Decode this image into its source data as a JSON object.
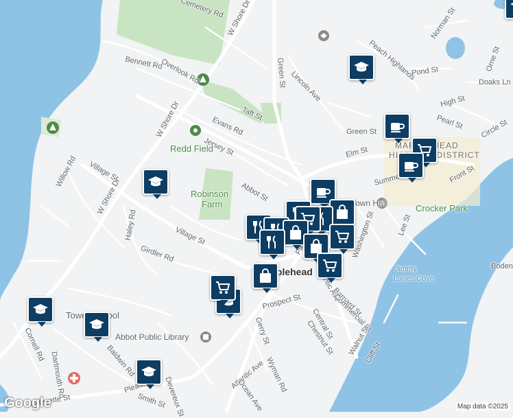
{
  "streets": [
    {
      "name": "Cemetery Rd",
      "rot": 20
    },
    {
      "name": "W Shore Dr",
      "rot": -62
    },
    {
      "name": "Bennett Rd",
      "rot": 12
    },
    {
      "name": "Overlook Rd",
      "rot": 30
    },
    {
      "name": "Green St",
      "rot": 85
    },
    {
      "name": "Lincoln Ave",
      "rot": 45
    },
    {
      "name": "Peach Highlands",
      "rot": 40
    },
    {
      "name": "Pond St",
      "rot": -8
    },
    {
      "name": "Norman St",
      "rot": -55
    },
    {
      "name": "Orne St",
      "rot": -70
    },
    {
      "name": "Doaks Ln",
      "rot": 0
    },
    {
      "name": "Taft St",
      "rot": 25
    },
    {
      "name": "Evans Rd",
      "rot": 25
    },
    {
      "name": "High St",
      "rot": -15
    },
    {
      "name": "Pearl St",
      "rot": 20
    },
    {
      "name": "Circle St",
      "rot": -30
    },
    {
      "name": "W Shore Dr",
      "rot": -62
    },
    {
      "name": "Green St",
      "rot": 0
    },
    {
      "name": "Elm St",
      "rot": -15
    },
    {
      "name": "Jersey St",
      "rot": 25
    },
    {
      "name": "Willow Rd",
      "rot": -62
    },
    {
      "name": "Village St",
      "rot": 30
    },
    {
      "name": "W Shore Dr",
      "rot": -62
    },
    {
      "name": "Abbot St",
      "rot": 30
    },
    {
      "name": "Summer St",
      "rot": -15
    },
    {
      "name": "Front St",
      "rot": -30
    },
    {
      "name": "Haley Rd",
      "rot": -80
    },
    {
      "name": "Village St",
      "rot": 25
    },
    {
      "name": "Girdler Rd",
      "rot": 20
    },
    {
      "name": "Lee St",
      "rot": -70
    },
    {
      "name": "Pleasant St",
      "rot": -60
    },
    {
      "name": "Prospect St",
      "rot": -15
    },
    {
      "name": "Atlantic Ave",
      "rot": 60
    },
    {
      "name": "Barnard St",
      "rot": 45
    },
    {
      "name": "Commercial St",
      "rot": 45
    },
    {
      "name": "Central St",
      "rot": 60
    },
    {
      "name": "Gerry St",
      "rot": 70
    },
    {
      "name": "Chestnut St",
      "rot": 55
    },
    {
      "name": "Walnut St",
      "rot": -60
    },
    {
      "name": "Cliff St",
      "rot": -60
    },
    {
      "name": "Cornell Rd",
      "rot": 65
    },
    {
      "name": "Baldwin Rd",
      "rot": 50
    },
    {
      "name": "Dartmouth Rd",
      "rot": 80
    },
    {
      "name": "Atlantic Ave",
      "rot": -40
    },
    {
      "name": "Wyman Rd",
      "rot": 65
    },
    {
      "name": "Pleasant St",
      "rot": -20
    },
    {
      "name": "Lafayette St",
      "rot": -10
    },
    {
      "name": "Smith St",
      "rot": 20
    },
    {
      "name": "Devereux St",
      "rot": 70
    },
    {
      "name": "Ocean Ave",
      "rot": 55
    },
    {
      "name": "Washington St",
      "rot": -70
    }
  ],
  "places": {
    "redd_field": "Redd Field",
    "robinson_farm_1": "Robinson",
    "robinson_farm_2": "Farm",
    "district_1": "MARBLEHEAD",
    "district_2": "HISTORIC DISTRICT",
    "town_hall": "Town Hall",
    "crocker_park": "Crocker Park",
    "jimmy_1": "Jimmy",
    "jimmy_2": "Lanes Cove",
    "marblehead": "Marblehead",
    "tower_school": "Tower School",
    "abbot_library": "Abbot Public Library",
    "boden": "Boden"
  },
  "pins": [
    {
      "type": "school"
    },
    {
      "type": "school"
    },
    {
      "type": "cafe"
    },
    {
      "type": "shop"
    },
    {
      "type": "cafe"
    },
    {
      "type": "school"
    },
    {
      "type": "cafe"
    },
    {
      "type": "restaurant"
    },
    {
      "type": "shopping-bag"
    },
    {
      "type": "restaurant"
    },
    {
      "type": "shop"
    },
    {
      "type": "restaurant"
    },
    {
      "type": "restaurant"
    },
    {
      "type": "shopping-bag"
    },
    {
      "type": "restaurant"
    },
    {
      "type": "shopping-bag"
    },
    {
      "type": "shop"
    },
    {
      "type": "shopping-bag"
    },
    {
      "type": "shop"
    },
    {
      "type": "school"
    },
    {
      "type": "school"
    },
    {
      "type": "school"
    },
    {
      "type": "school"
    }
  ],
  "icons": {
    "pin_bg": "#0d3d63",
    "water": "#8ec3e6",
    "park": "#c9e4c2",
    "land": "#f1f3f4",
    "road": "#ffffff",
    "downtown": "#f5ecd0"
  },
  "attribution": "Map data ©2025",
  "google": "Google"
}
